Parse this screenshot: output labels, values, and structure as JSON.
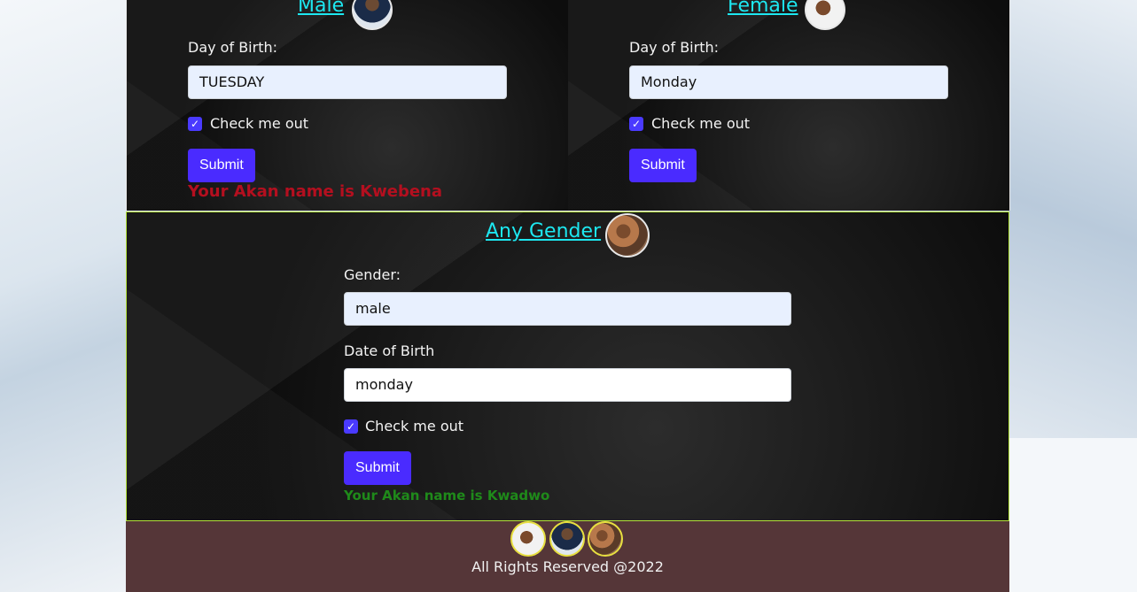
{
  "male": {
    "heading": "Male",
    "day_label": "Day of Birth:",
    "day_value": "TUESDAY",
    "check_label": "Check me out",
    "submit_label": "Submit",
    "result": "Your Akan name is Kwebena"
  },
  "female": {
    "heading": "Female",
    "day_label": "Day of Birth:",
    "day_value": "Monday",
    "check_label": "Check me out",
    "submit_label": "Submit"
  },
  "any": {
    "heading": "Any Gender",
    "gender_label": "Gender:",
    "gender_value": "male",
    "date_label": "Date of Birth",
    "date_value": "monday",
    "check_label": "Check me out",
    "submit_label": "Submit",
    "result": "Your Akan name is Kwadwo"
  },
  "footer": {
    "text": "All Rights Reserved @2022"
  },
  "icons": {
    "checkbox": "checkmark-icon",
    "avatars": [
      "male-avatar-icon",
      "female-avatar-icon",
      "couple-avatar-icon"
    ]
  },
  "colors": {
    "heading": "#1de7f0",
    "button": "#4a2bff",
    "error_result": "#b40f1f",
    "success_result": "#1f8a1a",
    "footer_bg": "#553638"
  }
}
